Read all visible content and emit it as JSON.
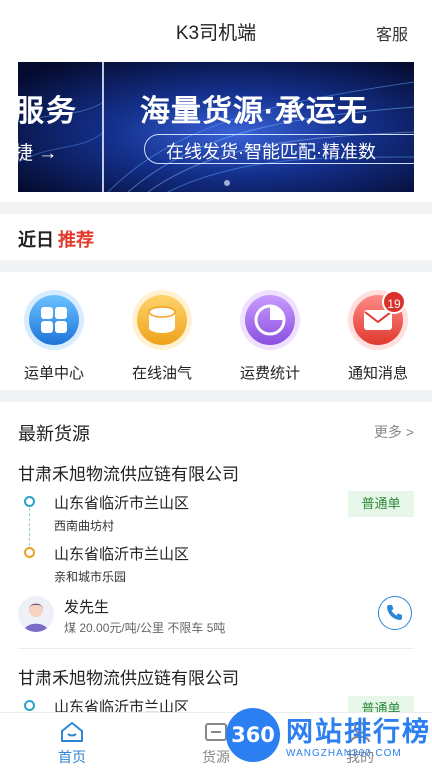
{
  "header": {
    "title": "K3司机端",
    "service": "客服"
  },
  "banner": {
    "left_big": "服务",
    "left_small": "捷 →",
    "headline": "海量货源·承运无",
    "subline": "在线发货·智能匹配·精准数"
  },
  "recommend": {
    "part1": "近日",
    "part2": "推荐"
  },
  "quick": [
    {
      "label": "运单中心",
      "icon": "waybill-grid-icon"
    },
    {
      "label": "在线油气",
      "icon": "oil-drum-icon"
    },
    {
      "label": "运费统计",
      "icon": "pie-chart-icon"
    },
    {
      "label": "通知消息",
      "icon": "envelope-icon",
      "badge": "19"
    }
  ],
  "goods": {
    "title": "最新货源",
    "more": "更多 >",
    "cards": [
      {
        "company": "甘肃禾旭物流供应链有限公司",
        "from": "山东省临沂市兰山区",
        "from_detail": "西南曲坊村",
        "to": "山东省临沂市兰山区",
        "to_detail": "亲和城市乐园",
        "tag": "普通单",
        "sender": "发先生",
        "cargo": "煤 20.00元/吨/公里 不限车 5吨"
      },
      {
        "company": "甘肃禾旭物流供应链有限公司",
        "from": "山东省临沂市兰山区",
        "tag": "普通单"
      }
    ]
  },
  "tabs": [
    {
      "label": "首页",
      "active": true
    },
    {
      "label": "货源",
      "active": false
    },
    {
      "label": "我的",
      "active": false
    }
  ],
  "watermark": {
    "circle": "360",
    "title": "网站排行榜",
    "sub": "WANGZHAN360.COM"
  },
  "colors": {
    "accent": "#2c87d8",
    "recommend_red": "#e23b2e",
    "tag_green": "#2e8b3a"
  }
}
